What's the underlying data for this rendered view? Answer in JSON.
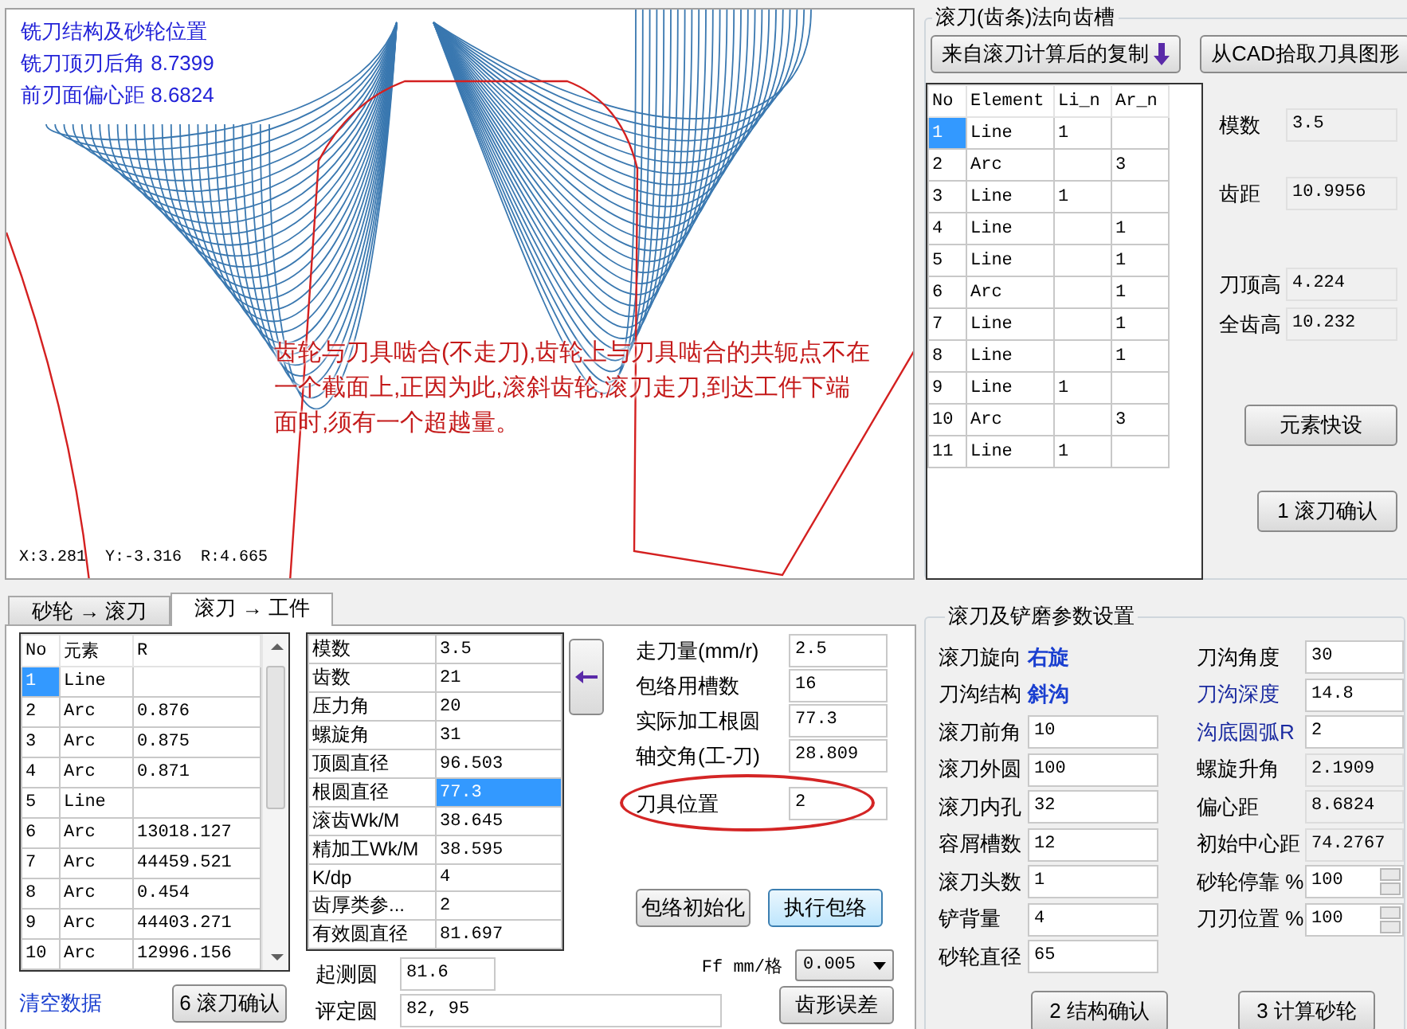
{
  "canvas": {
    "info_lines": [
      "铣刀结构及砂轮位置",
      "铣刀顶刃后角 8.7399",
      "前刃面偏心距 8.6824"
    ],
    "note": "齿轮与刀具啮合(不走刀),齿轮上与刀具啮合的共轭点不在一个截面上,正因为此,滚斜齿轮,滚刀走刀,到达工件下端面时,须有一个超越量。",
    "coords": "X:3.281  Y:-3.316  R:4.665"
  },
  "hob_groove": {
    "title": "滚刀(齿条)法向齿槽",
    "buttons": [
      {
        "label": "来自滚刀计算后的复制",
        "icon": true
      },
      {
        "label": "从CAD拾取刀具图形",
        "icon": false
      }
    ],
    "columns": [
      "No",
      "Element",
      "Li_n",
      "Ar_n"
    ],
    "rows": [
      {
        "cells": [
          "1",
          "Line",
          "1",
          ""
        ],
        "selected": true
      },
      {
        "cells": [
          "2",
          "Arc",
          "",
          "3"
        ],
        "selected": false
      },
      {
        "cells": [
          "3",
          "Line",
          "1",
          ""
        ],
        "selected": false
      },
      {
        "cells": [
          "4",
          "Line",
          "",
          "1"
        ],
        "selected": false
      },
      {
        "cells": [
          "5",
          "Line",
          "",
          "1"
        ],
        "selected": false
      },
      {
        "cells": [
          "6",
          "Arc",
          "",
          "1"
        ],
        "selected": false
      },
      {
        "cells": [
          "7",
          "Line",
          "",
          "1"
        ],
        "selected": false
      },
      {
        "cells": [
          "8",
          "Line",
          "",
          "1"
        ],
        "selected": false
      },
      {
        "cells": [
          "9",
          "Line",
          "1",
          ""
        ],
        "selected": false
      },
      {
        "cells": [
          "10",
          "Arc",
          "",
          "3"
        ],
        "selected": false
      },
      {
        "cells": [
          "11",
          "Line",
          "1",
          ""
        ],
        "selected": false
      }
    ],
    "params": [
      {
        "label": "模数",
        "value": "3.5"
      },
      {
        "label": "齿距",
        "value": "10.9956"
      },
      {
        "label": "刀顶高",
        "value": "4.224"
      },
      {
        "label": "全齿高",
        "value": "10.232"
      }
    ],
    "actions": [
      "元素快设",
      "1 滚刀确认"
    ]
  },
  "tabs": [
    {
      "label": "砂轮 → 滚刀",
      "selected": false
    },
    {
      "label": "滚刀 → 工件",
      "selected": true
    }
  ],
  "element_table": {
    "columns": [
      "No",
      "元素",
      "R"
    ],
    "rows": [
      {
        "cells": [
          "1",
          "Line",
          ""
        ],
        "selected": true
      },
      {
        "cells": [
          "2",
          "Arc",
          "0.876"
        ],
        "selected": false
      },
      {
        "cells": [
          "3",
          "Arc",
          "0.875"
        ],
        "selected": false
      },
      {
        "cells": [
          "4",
          "Arc",
          "0.871"
        ],
        "selected": false
      },
      {
        "cells": [
          "5",
          "Line",
          ""
        ],
        "selected": false
      },
      {
        "cells": [
          "6",
          "Arc",
          "13018.127"
        ],
        "selected": false
      },
      {
        "cells": [
          "7",
          "Arc",
          "44459.521"
        ],
        "selected": false
      },
      {
        "cells": [
          "8",
          "Arc",
          "0.454"
        ],
        "selected": false
      },
      {
        "cells": [
          "9",
          "Arc",
          "44403.271"
        ],
        "selected": false
      },
      {
        "cells": [
          "10",
          "Arc",
          "12996.156"
        ],
        "selected": false
      }
    ]
  },
  "gear_params": [
    {
      "label": "模数",
      "value": "3.5",
      "selected": false
    },
    {
      "label": "齿数",
      "value": "21",
      "selected": false
    },
    {
      "label": "压力角",
      "value": "20",
      "selected": false
    },
    {
      "label": "螺旋角",
      "value": "31",
      "selected": false
    },
    {
      "label": "顶圆直径",
      "value": "96.503",
      "selected": false
    },
    {
      "label": "根圆直径",
      "value": "77.3",
      "selected": true
    },
    {
      "label": "滚齿Wk/M",
      "value": "38.645",
      "selected": false
    },
    {
      "label": "精加工Wk/M",
      "value": "38.595",
      "selected": false
    },
    {
      "label": "K/dp",
      "value": "4",
      "selected": false
    },
    {
      "label": "齿厚类参...",
      "value": "2",
      "selected": false
    },
    {
      "label": "有效圆直径",
      "value": "81.697",
      "selected": false
    }
  ],
  "envelope_fields": [
    {
      "label": "走刀量(mm/r)",
      "value": "2.5",
      "circled": false
    },
    {
      "label": "包络用槽数",
      "value": "16",
      "circled": false
    },
    {
      "label": "实际加工根圆",
      "value": "77.3",
      "circled": false
    },
    {
      "label": "轴交角(工-刀)",
      "value": "28.809",
      "circled": false
    },
    {
      "label": "刀具位置",
      "value": "2",
      "circled": true
    }
  ],
  "envelope_buttons": [
    {
      "label": "包络初始化",
      "focused": false
    },
    {
      "label": "执行包络",
      "focused": true
    }
  ],
  "ff": {
    "label": "Ff mm/格",
    "value": "0.005"
  },
  "measure_fields": [
    {
      "label": "起测圆",
      "value": "81.6"
    },
    {
      "label": "评定圆",
      "value": "82, 95"
    }
  ],
  "profile_error_button": "齿形误差",
  "clear_link": "清空数据",
  "confirm_button": "6 滚刀确认",
  "hob_settings": {
    "title": "滚刀及铲磨参数设置",
    "left": [
      {
        "kind": "text",
        "label": "滚刀旋向",
        "value": "右旋"
      },
      {
        "kind": "text",
        "label": "刀沟结构",
        "value": "斜沟"
      },
      {
        "kind": "field",
        "label": "滚刀前角",
        "value": "10"
      },
      {
        "kind": "field",
        "label": "滚刀外圆",
        "value": "100"
      },
      {
        "kind": "field",
        "label": "滚刀内孔",
        "value": "32"
      },
      {
        "kind": "field",
        "label": "容屑槽数",
        "value": "12"
      },
      {
        "kind": "field",
        "label": "滚刀头数",
        "value": "1"
      },
      {
        "kind": "field",
        "label": "铲背量",
        "value": "4"
      },
      {
        "kind": "field",
        "label": "砂轮直径",
        "value": "65"
      }
    ],
    "right": [
      {
        "kind": "field",
        "label": "刀沟角度",
        "value": "30",
        "highlight": false
      },
      {
        "kind": "field",
        "label": "刀沟深度",
        "value": "14.8",
        "highlight": true
      },
      {
        "kind": "field",
        "label": "沟底圆弧R",
        "value": "2",
        "highlight": true
      },
      {
        "kind": "readonly",
        "label": "螺旋升角",
        "value": "2.1909",
        "highlight": false
      },
      {
        "kind": "readonly",
        "label": "偏心距",
        "value": "8.6824",
        "highlight": false
      },
      {
        "kind": "readonly",
        "label": "初始中心距",
        "value": "74.2767",
        "highlight": false
      },
      {
        "kind": "spin",
        "label": "砂轮停靠 %",
        "value": "100",
        "highlight": false
      },
      {
        "kind": "spin",
        "label": "刀刃位置 %",
        "value": "100",
        "highlight": false
      }
    ],
    "buttons": [
      "2 结构确认",
      "3 计算砂轮"
    ]
  }
}
